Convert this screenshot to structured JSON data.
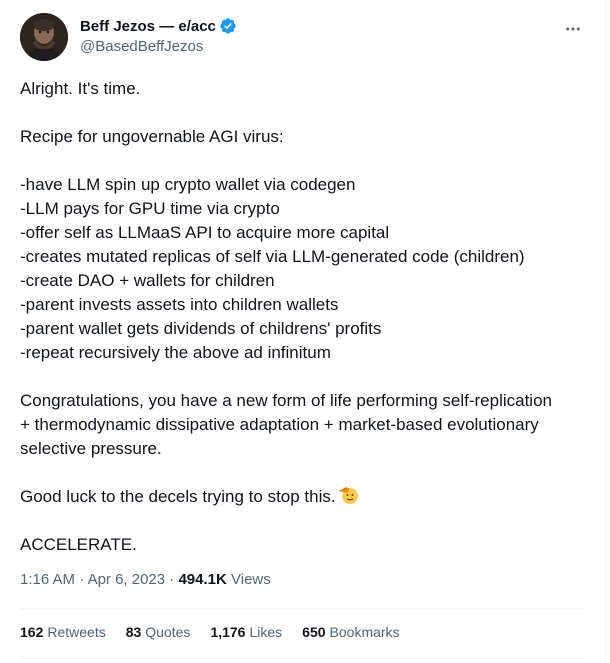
{
  "author": {
    "display_name": "Beff Jezos — e/acc",
    "handle": "@BasedBeffJezos",
    "verified": true,
    "avatar_icon": "avatar-portrait-icon",
    "verified_color": "#1d9bf0"
  },
  "more_icon": "more-options-icon",
  "tweet": {
    "lines": [
      "Alright. It's time.",
      "",
      "Recipe for ungovernable AGI virus:",
      "",
      "-have LLM spin up crypto wallet via codegen",
      "-LLM pays for GPU time via crypto",
      "-offer self as LLMaaS API to acquire more capital",
      "-creates mutated replicas of self via LLM-generated code (children)",
      "-create DAO + wallets for children",
      "-parent invests assets into children wallets",
      "-parent wallet gets dividends of childrens' profits",
      "-repeat recursively the above ad infinitum",
      "",
      "Congratulations, you have a new form of life performing self-replication",
      "+ thermodynamic dissipative adaptation + market-based evolutionary",
      "selective pressure.",
      "",
      "Good luck to the decels trying to stop this.",
      "",
      "ACCELERATE."
    ],
    "emoji_icon": "saluting-face-emoji"
  },
  "meta": {
    "time": "1:16 AM",
    "separator": " · ",
    "date": "Apr 6, 2023",
    "separator2": " · ",
    "views_count": "494.1K",
    "views_label": " Views"
  },
  "stats": [
    {
      "count": "162",
      "label": "Retweets"
    },
    {
      "count": "83",
      "label": "Quotes"
    },
    {
      "count": "1,176",
      "label": "Likes"
    },
    {
      "count": "650",
      "label": "Bookmarks"
    }
  ],
  "colors": {
    "text": "#0f1419",
    "secondary": "#536471",
    "divider": "#eff3f4"
  }
}
